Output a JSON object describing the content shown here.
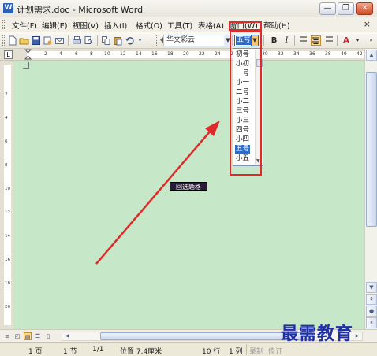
{
  "window": {
    "title": "计划需求.doc - Microsoft Word",
    "app_icon_glyph": "W",
    "controls": {
      "minimize": "—",
      "restore": "❐",
      "close": "✕"
    }
  },
  "menubar": {
    "items": [
      "文件(F)",
      "编辑(E)",
      "视图(V)",
      "插入(I)",
      "格式(O)",
      "工具(T)",
      "表格(A)",
      "窗口(W)",
      "帮助(H)"
    ],
    "close_glyph": "×"
  },
  "toolbar": {
    "style_value": "华文彩云",
    "size_value": "五号",
    "bold": "B",
    "italic": "I",
    "font_color_label": "A"
  },
  "font_size_dropdown": {
    "items": [
      "初号",
      "小初",
      "一号",
      "小一",
      "二号",
      "小二",
      "三号",
      "小三",
      "四号",
      "小四",
      "五号",
      "小五"
    ],
    "selected": "五号"
  },
  "ruler": {
    "tab_selector": "L",
    "numbers": [
      "2",
      "4",
      "6",
      "8",
      "10",
      "12",
      "14",
      "16",
      "18",
      "20",
      "22",
      "24",
      "26",
      "28",
      "30",
      "32",
      "34",
      "36",
      "38",
      "40",
      "42"
    ]
  },
  "left_ruler": {
    "numbers": [
      "2",
      "4",
      "6",
      "8",
      "10",
      "12",
      "14",
      "16",
      "18",
      "20"
    ]
  },
  "tooltip": {
    "text": "回选题格"
  },
  "statusbar": {
    "page": "1 页",
    "section": "1 节",
    "page_of": "1/1",
    "position": "位置 7.4厘米",
    "line": "10 行",
    "column": "1 列",
    "rec": "录制",
    "trk": "修订"
  },
  "watermark": {
    "text": "最需教育"
  },
  "colors": {
    "document_background": "#c7e8c8",
    "highlight_red": "#e02a2a",
    "selection_blue": "#316ac5",
    "watermark_blue": "#1f2fa8"
  }
}
